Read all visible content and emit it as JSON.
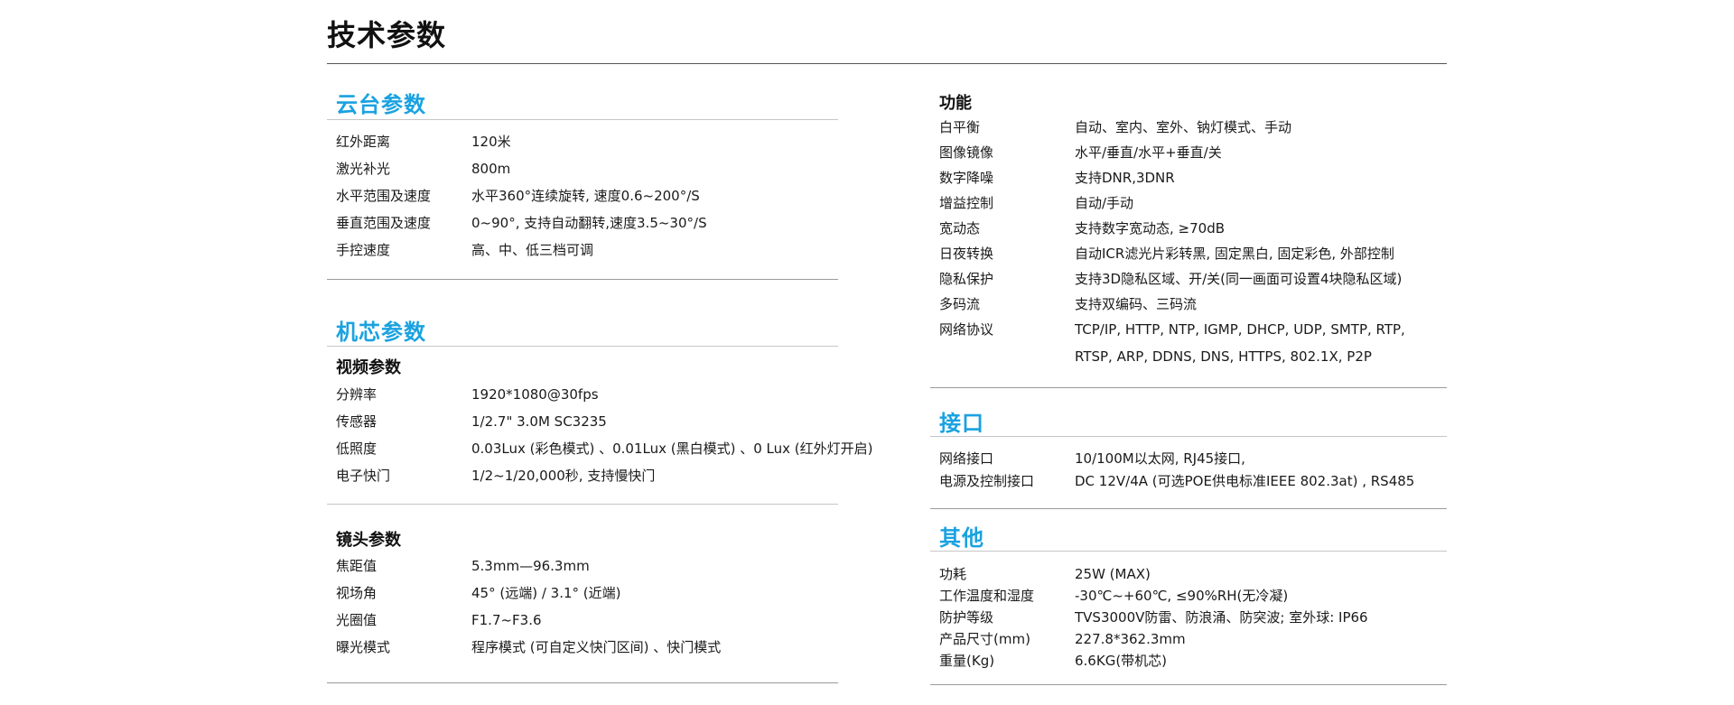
{
  "title": "技术参数",
  "left": {
    "ptz": {
      "title": "云台参数",
      "rows": [
        {
          "k": "红外距离",
          "v": "120米"
        },
        {
          "k": "激光补光",
          "v": "800m"
        },
        {
          "k": "水平范围及速度",
          "v": "水平360°连续旋转, 速度0.6~200°/S"
        },
        {
          "k": "垂直范围及速度",
          "v": "0~90°, 支持自动翻转,速度3.5~30°/S"
        },
        {
          "k": "手控速度",
          "v": "高、中、低三档可调"
        }
      ]
    },
    "core": {
      "title": "机芯参数",
      "video": {
        "title": "视频参数",
        "rows": [
          {
            "k": "分辨率",
            "v": "1920*1080@30fps"
          },
          {
            "k": "传感器",
            "v": "1/2.7\" 3.0M SC3235"
          },
          {
            "k": "低照度",
            "v": "0.03Lux (彩色模式) 、0.01Lux (黑白模式) 、0 Lux (红外灯开启)"
          },
          {
            "k": "电子快门",
            "v": "1/2~1/20,000秒, 支持慢快门"
          }
        ]
      },
      "lens": {
        "title": "镜头参数",
        "rows": [
          {
            "k": "焦距值",
            "v": "5.3mm—96.3mm"
          },
          {
            "k": "视场角",
            "v": "45° (远端) / 3.1° (近端)"
          },
          {
            "k": "光圈值",
            "v": "F1.7~F3.6"
          },
          {
            "k": "曝光模式",
            "v": "程序模式 (可自定义快门区间) 、快门模式"
          }
        ]
      }
    }
  },
  "right": {
    "func": {
      "title": "功能",
      "rows": [
        {
          "k": "白平衡",
          "v": "自动、室内、室外、钠灯模式、手动"
        },
        {
          "k": "图像镜像",
          "v": "水平/垂直/水平+垂直/关"
        },
        {
          "k": "数字降噪",
          "v": "支持DNR,3DNR"
        },
        {
          "k": "增益控制",
          "v": "自动/手动"
        },
        {
          "k": "宽动态",
          "v": "支持数字宽动态, ≥70dB"
        },
        {
          "k": "日夜转换",
          "v": "自动ICR滤光片彩转黑, 固定黑白, 固定彩色, 外部控制"
        },
        {
          "k": "隐私保护",
          "v": "支持3D隐私区域、开/关(同一画面可设置4块隐私区域)"
        },
        {
          "k": "多码流",
          "v": "支持双编码、三码流"
        },
        {
          "k": "网络协议",
          "v": "TCP/IP, HTTP, NTP, IGMP, DHCP, UDP, SMTP, RTP,"
        },
        {
          "k": "",
          "v": "RTSP, ARP, DDNS, DNS, HTTPS, 802.1X, P2P"
        }
      ]
    },
    "iface": {
      "title": "接口",
      "rows": [
        {
          "k": "网络接口",
          "v": "10/100M以太网, RJ45接口,"
        },
        {
          "k": "电源及控制接口",
          "v": "DC 12V/4A (可选POE供电标准IEEE 802.3at) , RS485"
        }
      ]
    },
    "other": {
      "title": "其他",
      "rows": [
        {
          "k": "功耗",
          "v": "25W (MAX)"
        },
        {
          "k": "工作温度和湿度",
          "v": "-30℃~+60℃, ≤90%RH(无冷凝)"
        },
        {
          "k": "防护等级",
          "v": "TVS3000V防雷、防浪涌、防突波; 室外球: IP66"
        },
        {
          "k": "产品尺寸(mm)",
          "v": "227.8*362.3mm"
        },
        {
          "k": "重量(Kg)",
          "v": "6.6KG(带机芯)"
        }
      ]
    }
  }
}
